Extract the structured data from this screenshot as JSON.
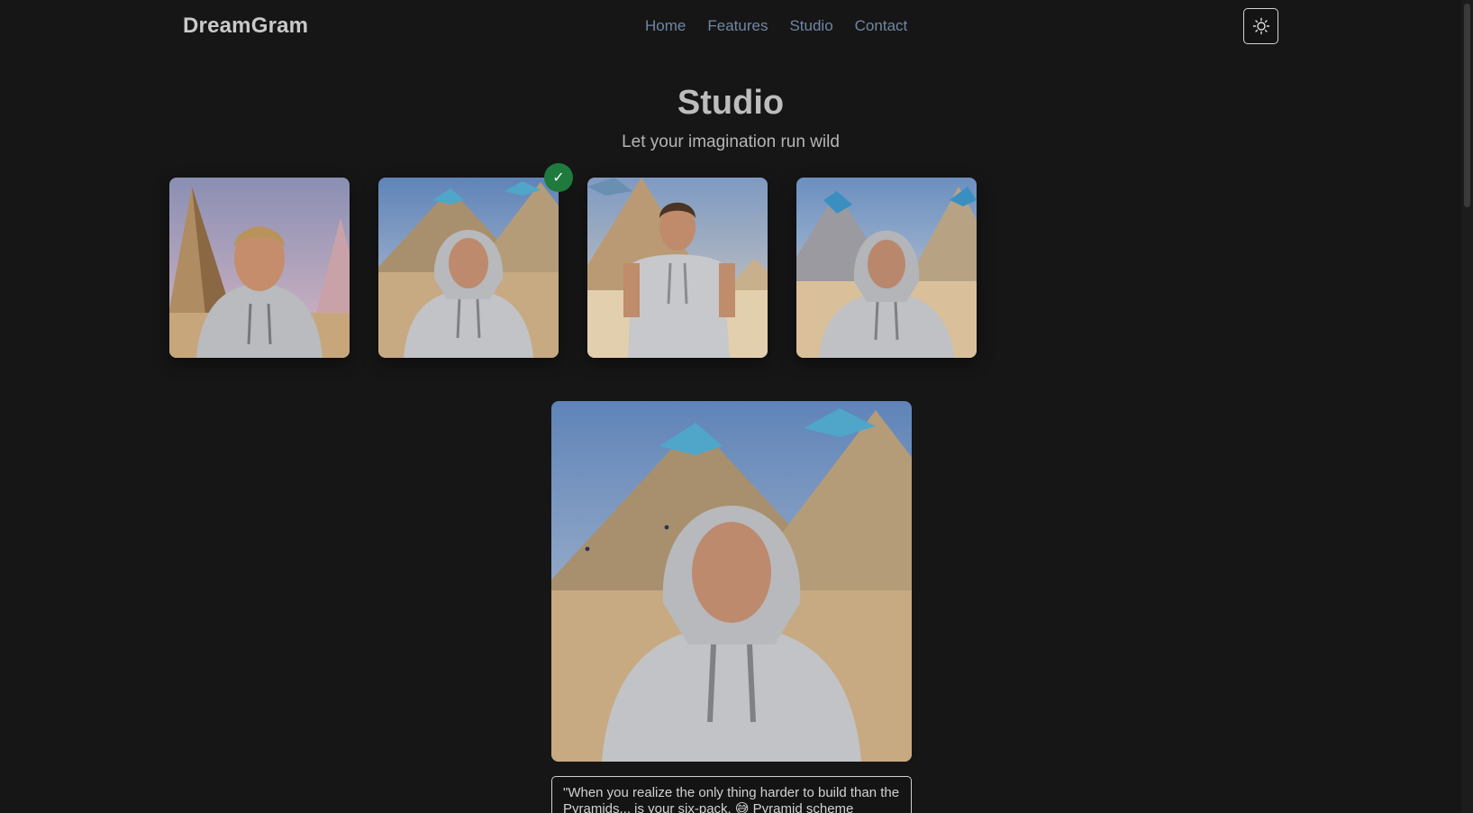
{
  "header": {
    "logo": "DreamGram",
    "nav": [
      "Home",
      "Features",
      "Studio",
      "Contact"
    ],
    "theme_toggle_icon": "sun-icon"
  },
  "hero": {
    "title": "Studio",
    "subtitle": "Let your imagination run wild"
  },
  "gallery": {
    "selected_index": 1,
    "selected_badge": "✓",
    "thumbnails": [
      "man-hoodie-pyramids-1",
      "man-hood-up-pyramids-2",
      "man-tshirt-hoodie-pyramid-3",
      "man-hood-up-pyramids-4"
    ]
  },
  "preview": {
    "image": "man-hood-up-pyramids-large"
  },
  "caption": {
    "text": "\"When you realize the only thing harder to build than the Pyramids... is your six-pack. 😅 Pyramid scheme"
  },
  "colors": {
    "background": "#161616",
    "nav_link": "#6f86a3",
    "badge": "#1f7a3e"
  }
}
